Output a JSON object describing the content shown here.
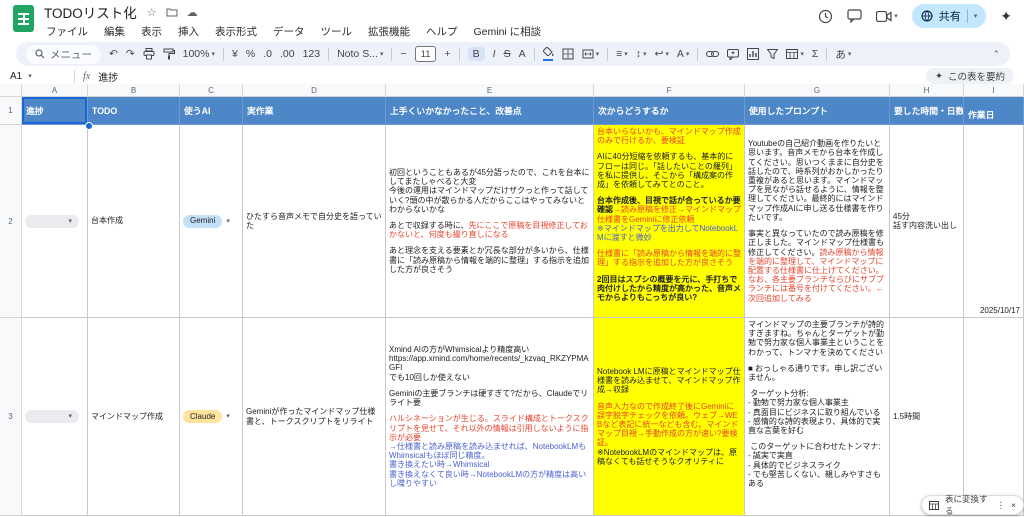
{
  "colors": {
    "header_bg": "#4d87c7",
    "highlight": "#ffff00",
    "red_text": "#e8432d",
    "blue_text": "#4a5fd3",
    "chip_gemini": "#c3e0f7",
    "chip_claude": "#ffe49c",
    "chip_empty": "#e9ebee",
    "share_bg": "#c2e7ff",
    "toolbar_bg": "#edf2fa"
  },
  "app": {
    "title": "TODOリスト化",
    "star": "☆",
    "cloud": "☁",
    "menus": [
      "ファイル",
      "編集",
      "表示",
      "挿入",
      "表示形式",
      "データ",
      "ツール",
      "拡張機能",
      "ヘルプ",
      "Gemini に相談"
    ],
    "share_label": "共有",
    "sparkle": "✦",
    "summarize_label": "この表を要約"
  },
  "toolbar": {
    "search_label": "メニュー",
    "zoom": "100%",
    "font_name": "Noto S...",
    "font_size": "11",
    "icons": {
      "undo": "↶",
      "redo": "↷",
      "currency": "¥",
      "percent": "%",
      "dec_less": ".0",
      "dec_more": ".00",
      "more_formats": "123",
      "minus": "−",
      "plus": "+",
      "bold": "B",
      "italic": "I",
      "strike": "S",
      "text_color": "A",
      "align": "≡",
      "valign": "↕",
      "wrap": "↩",
      "rotate": "A",
      "sigma": "Σ",
      "ime": "あ",
      "caret": "▾",
      "collapse": "⌃",
      "more": "⋮",
      "close": "×"
    }
  },
  "formula_bar": {
    "cell_ref": "A1",
    "fx_label": "fx",
    "value": "進捗"
  },
  "floating": {
    "convert_label": "表に変換する"
  },
  "grid": {
    "col_letters": [
      "A",
      "B",
      "C",
      "D",
      "E",
      "F",
      "G",
      "H",
      "I"
    ],
    "row_numbers": [
      "1",
      "2",
      "3"
    ],
    "header": [
      "進捗",
      "TODO",
      "使うAI",
      "実作業",
      "上手くいかなかったこと、改善点",
      "次からどうするか",
      "使用したプロンプト",
      "要した時間・日数",
      "作業日"
    ],
    "rows": [
      {
        "todo": "台本作成",
        "ai_label": "Gemini",
        "work": "ひたすら音声メモで自分史を語っていた",
        "issues": [
          [
            {
              "t": "初回ということもあるが45分語ったので、これを台本にしてまたしゃべると大変",
              "c": "k"
            }
          ],
          [
            {
              "t": "今後の運用はマインドマップだけザクっと作って話していく?頭の中が散らかる人だからここはやってみないとわからないかな",
              "c": "k"
            }
          ],
          [],
          [
            {
              "t": "あとで収録する時に、",
              "c": "k"
            },
            {
              "t": "先にここで原稿を目視修正しておかないと、何度も撮り直しになる",
              "c": "r"
            }
          ],
          [],
          [
            {
              "t": "あと理念を支える要素とか冗長な部分が多いから、仕様書に「読み原稿から情報を端的に整理」する指示を追加した方が良さそう",
              "c": "k"
            }
          ]
        ],
        "next": [
          [
            {
              "t": "台本いらないかも、マインドマップ作成のみで行けるか、要検証",
              "c": "r"
            }
          ],
          [],
          [
            {
              "t": "AIに40分短縮を依頼するも、基本的にフローは同じ。「話したいことの羅列」を私に提供し、そこから「構成案の作成」を依頼してみてとのこと。",
              "c": "k"
            }
          ],
          [],
          [
            {
              "t": "台本作成後、目視で話が合っているか要確認",
              "c": "kb"
            },
            {
              "t": "→読み原稿を修正→マインドマップ仕様書をGeminiに修正依頼",
              "c": "r"
            }
          ],
          [
            {
              "t": "※マインドマップを出力してNotebookLMに渡すと微妙",
              "c": "b"
            }
          ],
          [],
          [
            {
              "t": "仕様書に「読み原稿から情報を端的に整理」する指示を追加した方が良さそう",
              "c": "r"
            }
          ],
          [],
          [
            {
              "t": "2回目はスプシの概要を元に、手打ちで肉付けしたから精度が高かった、音声メモからよりもこっちが良い?",
              "c": "kb"
            }
          ]
        ],
        "prompt": [
          [
            {
              "t": "Youtubeの自己紹介動画を作りたいと思います。音声メモから台本を作成してください。思いつくままに自分史を話したので、時系列がおかしかったり重複があると思います。マインドマップを見ながら話せるように、情報を整理してください。最終的にはマインドマップ作成AIに申し送る仕様書を作りたいです。",
              "c": "k"
            }
          ],
          [],
          [
            {
              "t": "事実と異なっていたので読み原稿を修正しました。マインドマップ仕様書も修正してください。",
              "c": "k"
            },
            {
              "t": "読み原稿から情報を端的に整理して、マインドマップに配置する仕様書に仕上げてください。なお、各主要ブランチならびにサブブランチには番号を付けてください。←次回追加してみる",
              "c": "r"
            }
          ]
        ],
        "time": [
          [
            {
              "t": "45分",
              "c": "k"
            }
          ],
          [
            {
              "t": "話す内容洗い出し",
              "c": "k"
            }
          ]
        ],
        "date": "2025/10/17"
      },
      {
        "todo": "マインドマップ作成",
        "ai_label": "Claude",
        "work": "Geminiが作ったマインドマップ仕様書と、トークスクリプトをリライト",
        "issues": [
          [
            {
              "t": "Xmind AIの方がWhimsicalより精度高い",
              "c": "k"
            }
          ],
          [
            {
              "t": "https://app.xmind.com/home/recents/_kzvaq_RKZYPMAGFI",
              "c": "k"
            }
          ],
          [
            {
              "t": "でも10回しか使えない",
              "c": "k"
            }
          ],
          [],
          [
            {
              "t": "Geminiの主要ブランチは硬すぎて?だから、Claudeでリライト要",
              "c": "k"
            }
          ],
          [],
          [
            {
              "t": "ハルシネーションが生じる。スライド構成とトークスクリプトを見せて、それ以外の情報は引用しないように指示が必要",
              "c": "r"
            }
          ],
          [
            {
              "t": "→仕様書と読み原稿を読み込ませれば、NotebookLMもWhimsicalもほぼ同じ精度。",
              "c": "b"
            }
          ],
          [
            {
              "t": "書き換えたい時→Whimsical",
              "c": "b"
            }
          ],
          [
            {
              "t": "書き換えなくて良い時→NotebookLMの方が精度は高いし喋りやすい",
              "c": "b"
            }
          ]
        ],
        "next": [
          [
            {
              "t": "Notebook LMに原稿とマインドマップ仕様書を読み込ませて、マインドマップ作成→収録",
              "c": "k"
            }
          ],
          [],
          [
            {
              "t": "音声入力なので作成終了後にGeminiに誤字脱字チェックを依頼。ウェブ→WEBなど表記に統一なども含む。マインドマップ目視→手動作成の方が速い?要検証。",
              "c": "r"
            }
          ],
          [
            {
              "t": "※NotebookLMのマインドマップは、原稿なくても話せそうなクオリティに",
              "c": "k"
            }
          ]
        ],
        "prompt": [
          [
            {
              "t": "マインドマップの主要ブランチが詩的すぎますね。ちゃんとターゲットが勤勉で努力家な個人事業主ということをわかって、トンマナを決めてください",
              "c": "k"
            }
          ],
          [],
          [
            {
              "t": "■ おっしゃる通りです。申し訳ございません。",
              "c": "k"
            }
          ],
          [],
          [
            {
              "t": " ターゲット分析:",
              "c": "k"
            }
          ],
          [
            {
              "t": "- 勤勉で努力家な個人事業主",
              "c": "k"
            }
          ],
          [
            {
              "t": "- 真面目にビジネスに取り組んでいる",
              "c": "k"
            }
          ],
          [
            {
              "t": "- 感情的な詩的表現より、具体的で実直な言葉を好む",
              "c": "k"
            }
          ],
          [],
          [
            {
              "t": " このターゲットに合わせたトンマナ:",
              "c": "k"
            }
          ],
          [
            {
              "t": "- 誠実で実直",
              "c": "k"
            }
          ],
          [
            {
              "t": "- 具体的でビジネスライク",
              "c": "k"
            }
          ],
          [
            {
              "t": "- でも堅苦しくない、親しみやすさもある",
              "c": "k"
            }
          ]
        ],
        "time": [
          [
            {
              "t": "1.5時間",
              "c": "k"
            }
          ]
        ],
        "date": ""
      }
    ]
  }
}
